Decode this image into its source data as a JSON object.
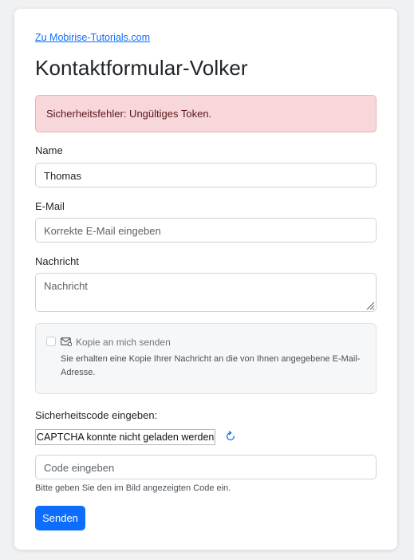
{
  "header": {
    "back_link": "Zu Mobirise-Tutorials.com",
    "title": "Kontaktformular-Volker"
  },
  "alert": {
    "message": "Sicherheitsfehler: Ungültiges Token.",
    "color_bg": "#f8d7da",
    "color_text": "#58151c"
  },
  "form": {
    "name": {
      "label": "Name",
      "value": "Thomas"
    },
    "email": {
      "label": "E-Mail",
      "placeholder": "Korrekte E-Mail eingeben"
    },
    "message": {
      "label": "Nachricht",
      "placeholder": "Nachricht"
    },
    "copy_option": {
      "label": "Kopie an mich senden",
      "checked": false,
      "icon": "envelope-icon",
      "help": "Sie erhalten eine Kopie Ihrer Nachricht an die von Ihnen angegebene E-Mail-Adresse."
    },
    "captcha": {
      "label": "Sicherheitscode eingeben:",
      "image_text": "CAPTCHA konnte nicht geladen werden",
      "refresh_icon": "refresh-icon",
      "input_placeholder": "Code eingeben",
      "help": "Bitte geben Sie den im Bild angezeigten Code ein."
    },
    "submit_label": "Senden",
    "accent_color": "#0d6efd"
  }
}
